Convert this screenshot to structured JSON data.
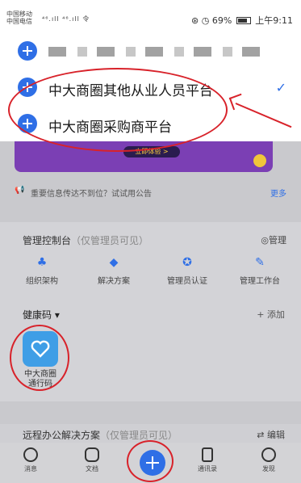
{
  "status_bar": {
    "carrier_1": "中国移动",
    "carrier_2": "中国电信",
    "signal": "⁴⁶.ıll ⁴⁶.ıll 令",
    "icons": "⊛ ◷ 69%",
    "time": "上午9:11"
  },
  "org_switcher": {
    "current_masked": true,
    "items": [
      {
        "label": "中大商圈其他从业人员平台",
        "selected": true
      },
      {
        "label": "中大商圈采购商平台",
        "selected": false
      }
    ],
    "check_icon": "check-icon"
  },
  "banner": {
    "button_label": "立即体验 >"
  },
  "notice": {
    "text": "重要信息传达不到位？试试用公告",
    "more_label": "更多"
  },
  "console": {
    "title": "管理控制台",
    "title_note": "（仅管理员可见）",
    "manage_label": "◎管理",
    "tools": [
      {
        "icon": "org-chart-icon",
        "label": "组织架构"
      },
      {
        "icon": "solution-icon",
        "label": "解决方案"
      },
      {
        "icon": "admin-badge-icon",
        "label": "管理员认证"
      },
      {
        "icon": "wrench-icon",
        "label": "管理工作台"
      }
    ]
  },
  "health": {
    "title": "健康码 ▾",
    "add_label": "+ 添加",
    "app_label_line1": "中大商圈",
    "app_label_line2": "通行码"
  },
  "remote": {
    "title": "远程办公解决方案",
    "title_note": "（仅管理员可见）",
    "edit_label": "⇄ 编辑"
  },
  "tabbar": {
    "tabs": [
      {
        "label": "消息"
      },
      {
        "label": "文档"
      },
      {
        "label": ""
      },
      {
        "label": "通讯录"
      },
      {
        "label": "发现"
      }
    ]
  },
  "colors": {
    "accent": "#2f6fe6",
    "annotation_red": "#d8222a",
    "banner_purple": "#7b3fb4"
  }
}
